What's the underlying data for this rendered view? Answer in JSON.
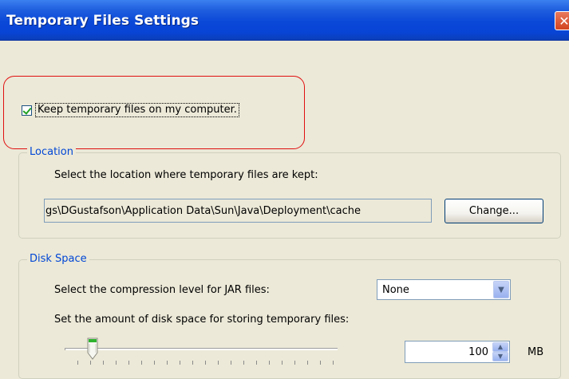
{
  "window": {
    "title": "Temporary Files Settings",
    "close_icon": "close-icon"
  },
  "keep_files": {
    "label": "Keep temporary files on my computer.",
    "checked": true
  },
  "location": {
    "legend": "Location",
    "description": "Select the location where temporary files are kept:",
    "path": "gs\\DGustafson\\Application Data\\Sun\\Java\\Deployment\\cache",
    "change_button": "Change..."
  },
  "disk_space": {
    "legend": "Disk Space",
    "compression_label": "Select the compression level for JAR files:",
    "compression_value": "None",
    "amount_label": "Set the amount of disk space for storing temporary files:",
    "amount_value": "100",
    "amount_unit": "MB",
    "slider_level": 0.12
  },
  "colors": {
    "title_bar": "#0a48d8",
    "legend_text": "#0046d5",
    "highlight": "#e01010"
  }
}
